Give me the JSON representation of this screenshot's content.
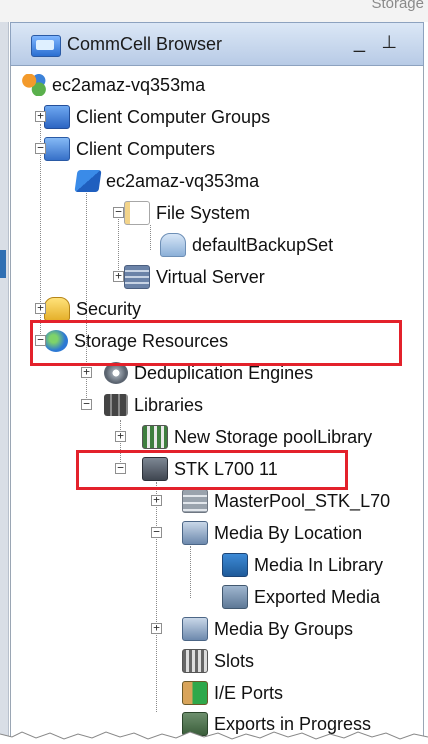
{
  "background_header_text": "Storage",
  "window": {
    "title": "CommCell Browser",
    "minimize_glyph": "_",
    "pin_glyph": "⊥"
  },
  "tree": [
    {
      "id": "root",
      "label": "ec2amaz-vq353ma",
      "icon": "commcell-icon",
      "expander": "none"
    },
    {
      "id": "client-computer-groups",
      "label": "Client Computer Groups",
      "icon": "computer-group-icon",
      "expander": "+"
    },
    {
      "id": "client-computers",
      "label": "Client Computers",
      "icon": "client-computers-icon",
      "expander": "−"
    },
    {
      "id": "client-ec2",
      "label": "ec2amaz-vq353ma",
      "icon": "windows-client-icon",
      "expander": "−"
    },
    {
      "id": "file-system",
      "label": "File System",
      "icon": "file-system-icon",
      "expander": "−"
    },
    {
      "id": "default-backup-set",
      "label": "defaultBackupSet",
      "icon": "backup-set-icon",
      "expander": "none"
    },
    {
      "id": "virtual-server",
      "label": "Virtual Server",
      "icon": "virtual-server-icon",
      "expander": "+"
    },
    {
      "id": "security",
      "label": "Security",
      "icon": "security-lock-icon",
      "expander": "+"
    },
    {
      "id": "storage-resources",
      "label": "Storage Resources",
      "icon": "globe-icon",
      "expander": "−"
    },
    {
      "id": "dedup-engines",
      "label": "Deduplication Engines",
      "icon": "dedup-engine-icon",
      "expander": "+"
    },
    {
      "id": "libraries",
      "label": "Libraries",
      "icon": "libraries-icon",
      "expander": "−"
    },
    {
      "id": "new-storage-pool",
      "label": "New Storage poolLibrary",
      "icon": "storage-pool-icon",
      "expander": "+"
    },
    {
      "id": "stk-l700",
      "label": "STK L700 11",
      "icon": "tape-library-icon",
      "expander": "−"
    },
    {
      "id": "masterpool",
      "label": "MasterPool_STK_L70",
      "icon": "master-pool-icon",
      "expander": "+"
    },
    {
      "id": "media-by-location",
      "label": "Media By Location",
      "icon": "media-location-icon",
      "expander": "−"
    },
    {
      "id": "media-in-library",
      "label": "Media In Library",
      "icon": "media-in-library-icon",
      "expander": "none"
    },
    {
      "id": "exported-media",
      "label": "Exported Media",
      "icon": "exported-media-icon",
      "expander": "none"
    },
    {
      "id": "media-by-groups",
      "label": "Media By Groups",
      "icon": "media-groups-icon",
      "expander": "+"
    },
    {
      "id": "slots",
      "label": "Slots",
      "icon": "slots-icon",
      "expander": "none"
    },
    {
      "id": "ie-ports",
      "label": "I/E Ports",
      "icon": "ie-ports-icon",
      "expander": "none"
    },
    {
      "id": "exports-in-progress",
      "label": "Exports in Progress",
      "icon": "exports-progress-icon",
      "expander": "none"
    }
  ],
  "highlight_color": "#e3212b"
}
